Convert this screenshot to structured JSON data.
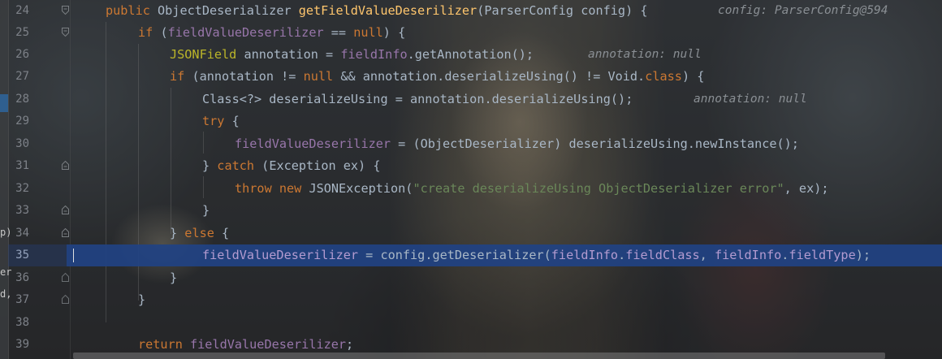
{
  "left_panel": {
    "fragments": [
      "p)",
      "er",
      "d,"
    ]
  },
  "editor": {
    "lines": [
      {
        "num": "24",
        "hint": "config: ParserConfig@594"
      },
      {
        "num": "25"
      },
      {
        "num": "26",
        "hint": "annotation: null"
      },
      {
        "num": "27"
      },
      {
        "num": "28",
        "hint": "annotation: null"
      },
      {
        "num": "29"
      },
      {
        "num": "30"
      },
      {
        "num": "31"
      },
      {
        "num": "32",
        "string": "\"create deserializeUsing ObjectDeserializer error\""
      },
      {
        "num": "33"
      },
      {
        "num": "34"
      },
      {
        "num": "35"
      },
      {
        "num": "36"
      },
      {
        "num": "37"
      },
      {
        "num": "38"
      },
      {
        "num": "39"
      }
    ],
    "execution_line": "35",
    "colors": {
      "keyword": "#cc7832",
      "method_decl": "#ffc66d",
      "field": "#9876aa",
      "annotation": "#bbb529",
      "string": "#6a8759",
      "plain": "#a9b7c6",
      "execution_highlight": "#214283"
    }
  }
}
